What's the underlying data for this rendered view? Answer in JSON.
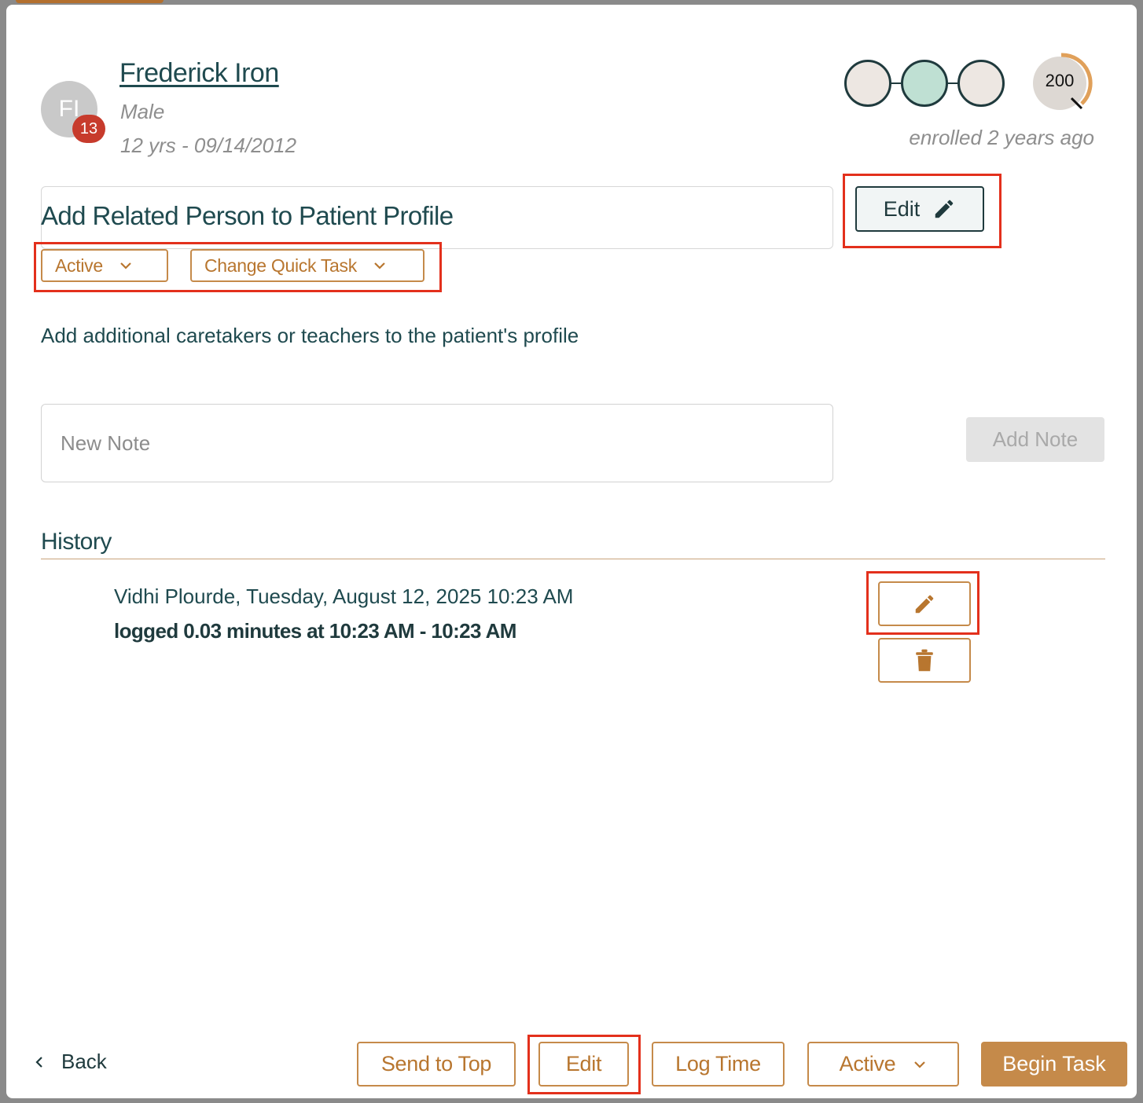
{
  "patient": {
    "initials": "FI",
    "badge_count": "13",
    "name": "Frederick Iron",
    "gender": "Male",
    "age_dob": "12 yrs - 09/14/2012"
  },
  "progress": {
    "steps": 3,
    "active_step": 2,
    "score": "200",
    "enrolled": "enrolled 2 years ago"
  },
  "task": {
    "title": "Add Related Person to Patient Profile",
    "edit_label": "Edit",
    "status_label": "Active",
    "quick_task_label": "Change Quick Task",
    "description": "Add additional caretakers or teachers to the patient's profile"
  },
  "note": {
    "placeholder": "New Note",
    "add_label": "Add Note"
  },
  "history": {
    "title": "History",
    "entries": [
      {
        "meta": "Vidhi Plourde, Tuesday, August 12, 2025 10:23 AM",
        "log": "logged 0.03 minutes at 10:23 AM - 10:23 AM"
      }
    ]
  },
  "footer": {
    "back_label": "Back",
    "send_to_top_label": "Send to Top",
    "edit_label": "Edit",
    "log_time_label": "Log Time",
    "status_label": "Active",
    "begin_task_label": "Begin Task"
  },
  "colors": {
    "accent": "#c58a4a",
    "primary_text": "#1f4a4f",
    "highlight": "#e3301c",
    "badge": "#c73b2c",
    "step_active": "#bfe0d3"
  },
  "icons": {
    "edit": "pencil-icon",
    "delete": "trash-icon",
    "dropdown": "chevron-down-icon",
    "back": "chevron-left-icon"
  }
}
